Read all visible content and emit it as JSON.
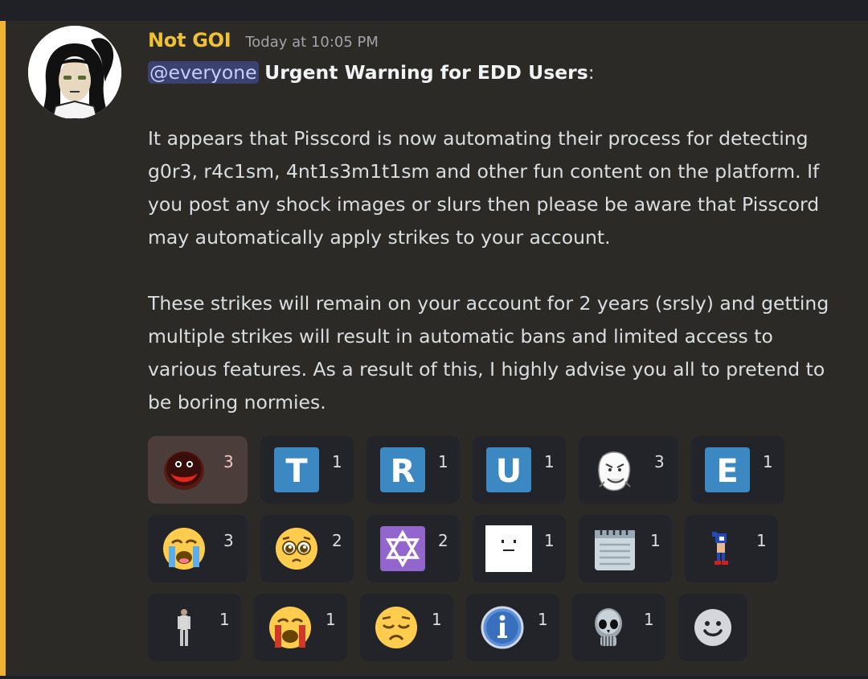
{
  "message": {
    "author": "Not GOI",
    "timestamp": "Today at 10:05 PM",
    "mention": "@everyone",
    "heading": "Urgent Warning for EDD Users",
    "heading_suffix": ":",
    "paragraph1": "It appears that Pisscord is now automating their process for detecting g0r3, r4c1sm, 4nt1s3m1t1sm and other fun content on the platform. If you post any shock images or slurs then please be aware that Pisscord may automatically apply strikes to your account.",
    "paragraph2": "These strikes will remain on your account for 2 years (srsly) and getting multiple strikes will result in automatic bans and limited access to various features. As a result of this, I highly advise you all to pretend to be boring normies."
  },
  "reactions": [
    [
      {
        "icon": "red-blob-face-emoji",
        "count": "3",
        "selected": true
      },
      {
        "icon": "regional-t-emoji",
        "letter": "T",
        "count": "1"
      },
      {
        "icon": "regional-r-emoji",
        "letter": "R",
        "count": "1"
      },
      {
        "icon": "regional-u-emoji",
        "letter": "U",
        "count": "1"
      },
      {
        "icon": "rage-face-emoji",
        "count": "3"
      },
      {
        "icon": "regional-e-emoji",
        "letter": "E",
        "count": "1"
      }
    ],
    [
      {
        "icon": "loudly-crying-emoji",
        "count": "3"
      },
      {
        "icon": "pleading-face-emoji",
        "count": "2"
      },
      {
        "icon": "star-of-david-emoji",
        "count": "2"
      },
      {
        "icon": "white-block-face-emoji",
        "count": "1"
      },
      {
        "icon": "notepad-emoji",
        "count": "1"
      },
      {
        "icon": "sonic-sprite-emoji",
        "count": "1"
      }
    ],
    [
      {
        "icon": "standing-man-emoji",
        "count": "1"
      },
      {
        "icon": "crying-face-emoji",
        "count": "1"
      },
      {
        "icon": "disappointed-face-emoji",
        "count": "1"
      },
      {
        "icon": "info-icon-emoji",
        "count": "1"
      },
      {
        "icon": "metal-skull-emoji",
        "count": "1"
      }
    ]
  ],
  "add_reaction_icon": "add-reaction-smiley-icon",
  "colors": {
    "background": "#2b2a26",
    "accent_bar": "#f0b232",
    "username": "#f0c133",
    "mention_bg": "#3c4270",
    "reaction_bg": "#23242a",
    "reaction_selected_bg": "#4b3e3a",
    "regional_blue": "#3b88c3"
  }
}
